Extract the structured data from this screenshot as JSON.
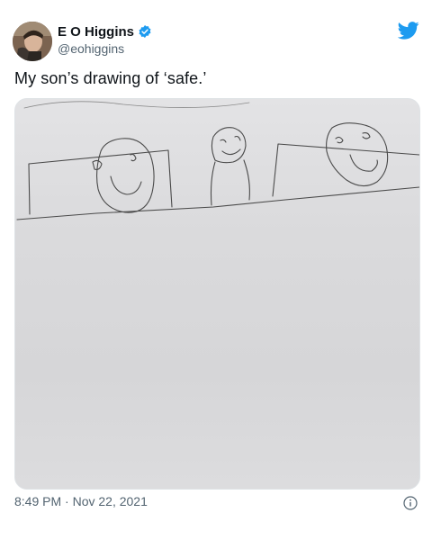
{
  "author": {
    "name": "E O Higgins",
    "handle": "@eohiggins",
    "verified": true,
    "avatar_icon": "profile-photo"
  },
  "platform_icon": "twitter-bird-icon",
  "tweet": {
    "text": "My son’s drawing of ‘safe.’",
    "media_icon": "child-drawing-image"
  },
  "meta": {
    "time": "8:49 PM",
    "separator": "·",
    "date": "Nov 22, 2021",
    "info_icon": "info-icon"
  },
  "colors": {
    "twitter_blue": "#1d9bf0",
    "text_primary": "#0f1419",
    "text_secondary": "#536471"
  }
}
